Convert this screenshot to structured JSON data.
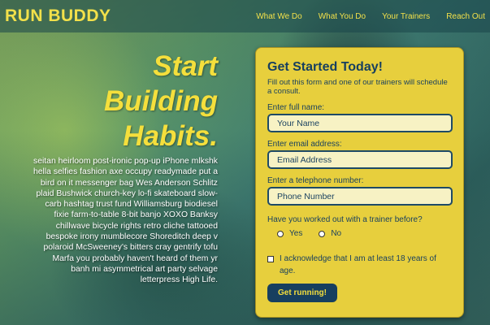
{
  "header": {
    "logo": "RUN BUDDY",
    "nav": [
      "What We Do",
      "What You Do",
      "Your Trainers",
      "Reach Out"
    ]
  },
  "intro": {
    "heading_line1": "Start",
    "heading_line2": "Building",
    "heading_line3": "Habits.",
    "body": "seitan heirloom post-ironic pop-up iPhone mlkshk hella selfies fashion axe occupy readymade put a bird on it messenger bag Wes Anderson Schlitz plaid Bushwick church-key lo-fi skateboard slow-carb hashtag trust fund Williamsburg biodiesel fixie farm-to-table 8-bit banjo XOXO Banksy chillwave bicycle rights retro cliche tattooed bespoke irony mumblecore Shoreditch deep v polaroid McSweeney's bitters cray gentrify tofu Marfa you probably haven't heard of them yr banh mi asymmetrical art party selvage letterpress High Life."
  },
  "form": {
    "title": "Get Started Today!",
    "subtitle": "Fill out this form and one of our trainers will schedule a consult.",
    "name_label": "Enter full name:",
    "name_placeholder": "Your Name",
    "email_label": "Enter email address:",
    "email_placeholder": "Email Address",
    "phone_label": "Enter a telephone number:",
    "phone_placeholder": "Phone Number",
    "question": "Have you worked out with a trainer before?",
    "yes_label": "Yes",
    "no_label": "No",
    "ack_label": "I acknowledge that I am at least 18 years of age.",
    "submit_label": "Get running!"
  },
  "colors": {
    "accent_yellow": "#f5df3c",
    "card_yellow": "#e7cf3d",
    "navy": "#173f5f"
  }
}
